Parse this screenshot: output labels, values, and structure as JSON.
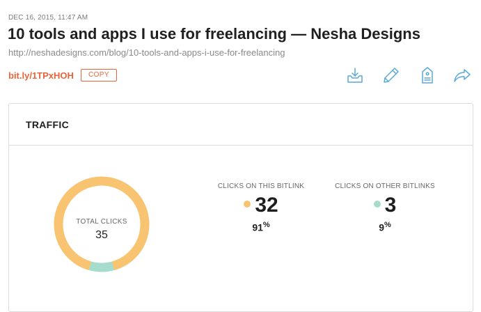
{
  "link": {
    "timestamp": "DEC 16, 2015, 11:47 AM",
    "title": "10 tools and apps I use for freelancing — Nesha Designs",
    "long_url": "http://neshadesigns.com/blog/10-tools-and-apps-i-use-for-freelancing",
    "short_url": "bit.ly/1TPxHOH",
    "copy_label": "COPY"
  },
  "actions": [
    {
      "icon": "inbox-download-icon"
    },
    {
      "icon": "pencil-icon"
    },
    {
      "icon": "tag-icon"
    },
    {
      "icon": "share-arrow-icon"
    }
  ],
  "traffic": {
    "title": "TRAFFIC",
    "total_label": "TOTAL CLICKS",
    "total_value": "35",
    "this_label": "CLICKS ON THIS BITLINK",
    "this_value": "32",
    "this_pct": "91",
    "other_label": "CLICKS ON OTHER BITLINKS",
    "other_value": "3",
    "other_pct": "9",
    "pct_symbol": "%"
  },
  "chart_data": {
    "type": "pie",
    "categories": [
      "CLICKS ON THIS BITLINK",
      "CLICKS ON OTHER BITLINKS"
    ],
    "values": [
      32,
      3
    ],
    "colors": [
      "#f8c471",
      "#a5dccb"
    ]
  },
  "colors": {
    "accent": "#e8633a",
    "icon": "#5aa9d6",
    "this_series": "#f8c471",
    "other_series": "#a5dccb"
  }
}
